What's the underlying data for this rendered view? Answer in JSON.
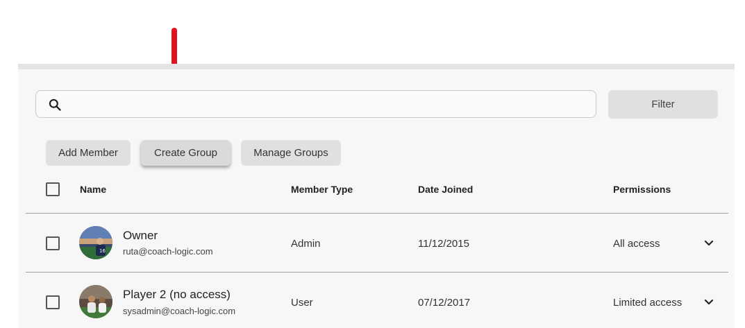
{
  "search": {
    "placeholder": "",
    "value": ""
  },
  "toolbar": {
    "filter_label": "Filter",
    "add_member_label": "Add Member",
    "create_group_label": "Create Group",
    "manage_groups_label": "Manage Groups"
  },
  "table": {
    "headers": {
      "name": "Name",
      "member_type": "Member Type",
      "date_joined": "Date Joined",
      "permissions": "Permissions"
    },
    "rows": [
      {
        "name": "Owner",
        "email": "ruta@coach-logic.com",
        "member_type": "Admin",
        "date_joined": "11/12/2015",
        "permissions": "All access"
      },
      {
        "name": "Player 2 (no access)",
        "email": "sysadmin@coach-logic.com",
        "member_type": "User",
        "date_joined": "07/12/2017",
        "permissions": "Limited access"
      }
    ]
  },
  "annotation": {
    "arrow_color": "#e3111e",
    "icon": "down-arrow-annotation"
  },
  "icons": [
    "search-icon",
    "chevron-down-icon",
    "avatar"
  ]
}
